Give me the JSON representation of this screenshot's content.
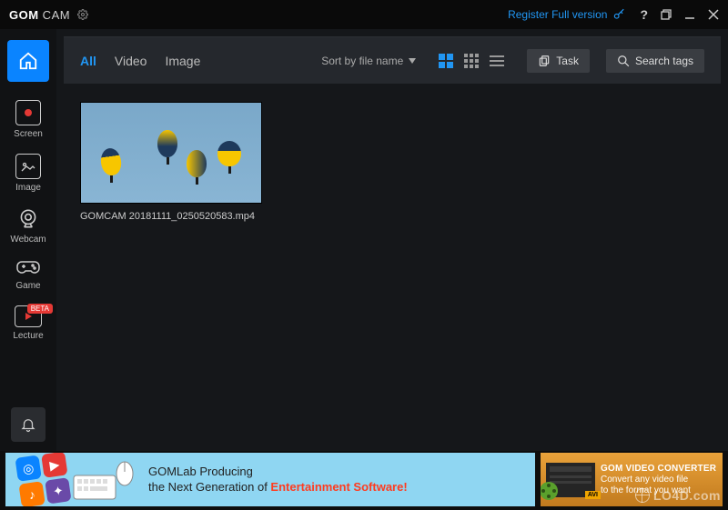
{
  "titlebar": {
    "brand_bold": "GOM",
    "brand_rest": " CAM",
    "register_label": "Register Full version"
  },
  "sidebar": {
    "items": [
      {
        "label": "",
        "icon": "home"
      },
      {
        "label": "Screen",
        "icon": "screen"
      },
      {
        "label": "Image",
        "icon": "image"
      },
      {
        "label": "Webcam",
        "icon": "webcam"
      },
      {
        "label": "Game",
        "icon": "game"
      },
      {
        "label": "Lecture",
        "icon": "lecture",
        "badge": "BETA"
      }
    ]
  },
  "tabs": {
    "all": "All",
    "video": "Video",
    "image": "Image"
  },
  "toolbar": {
    "sort_label": "Sort by file name",
    "task_label": "Task",
    "search_label": "Search tags"
  },
  "gallery": {
    "items": [
      {
        "filename": "GOMCAM 20181111_0250520583.mp4"
      }
    ]
  },
  "ads": {
    "ad1_line1": "GOMLab Producing",
    "ad1_line2_pre": "the Next Generation of ",
    "ad1_line2_hi": "Entertainment Software!",
    "ad2_title": "GOM VIDEO CONVERTER",
    "ad2_line1": "Convert any video file",
    "ad2_line2": "to the format you want"
  },
  "watermark": "LO4D.com"
}
